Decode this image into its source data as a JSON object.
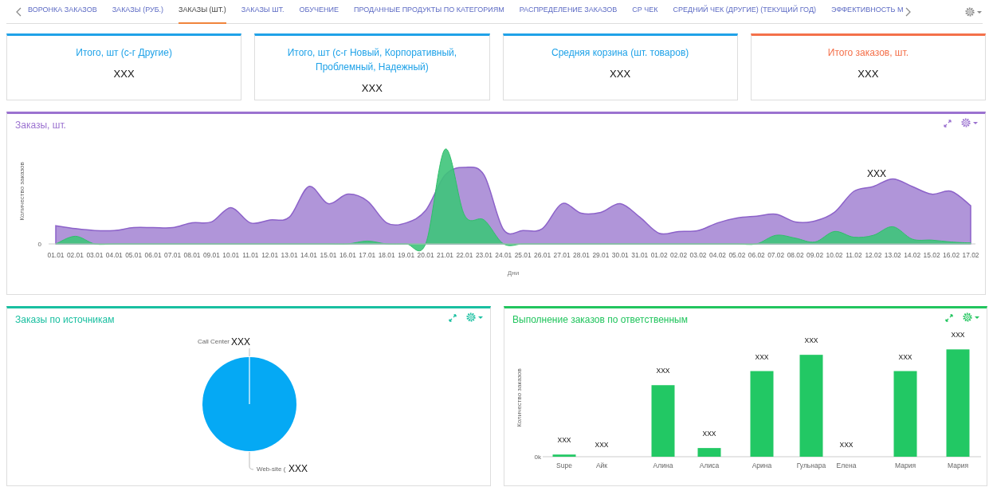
{
  "tabs": [
    {
      "label": "ВОРОНКА ЗАКАЗОВ",
      "selected": false
    },
    {
      "label": "ЗАКАЗЫ (РУБ.)",
      "selected": false
    },
    {
      "label": "ЗАКАЗЫ (ШТ.)",
      "selected": true
    },
    {
      "label": "ЗАКАЗЫ ШТ.",
      "selected": false
    },
    {
      "label": "ОБУЧЕНИЕ",
      "selected": false
    },
    {
      "label": "ПРОДАННЫЕ ПРОДУКТЫ ПО КАТЕГОРИЯМ",
      "selected": false
    },
    {
      "label": "РАСПРЕДЕЛЕНИЕ ЗАКАЗОВ",
      "selected": false
    },
    {
      "label": "СР ЧЕК",
      "selected": false
    },
    {
      "label": "СРЕДНИЙ ЧЕК (ДРУГИЕ) (ТЕКУЩИЙ ГОД)",
      "selected": false
    },
    {
      "label": "ЭФФЕКТИВНОСТЬ М",
      "selected": false
    }
  ],
  "kpis": [
    {
      "title": "Итого, шт (с-г Другие)",
      "value": "XXX",
      "color": "#1fa2e8"
    },
    {
      "title": "Итого, шт (с-г Новый, Корпоративный, Проблемный, Надежный)",
      "value": "XXX",
      "color": "#1fa2e8"
    },
    {
      "title": "Средняя корзина (шт. товаров)",
      "value": "XXX",
      "color": "#1fa2e8"
    },
    {
      "title": "Итого заказов, шт.",
      "value": "XXX",
      "color": "#f4704a"
    }
  ],
  "orders_chart": {
    "title": "Заказы, шт.",
    "ylabel": "Количество заказов",
    "y_zero": "0",
    "xlabel": "Дни",
    "peak_label": "XXX",
    "x_labels": [
      "01.01",
      "02.01",
      "03.01",
      "04.01",
      "05.01",
      "06.01",
      "07.01",
      "08.01",
      "09.01",
      "10.01",
      "11.01",
      "12.01",
      "13.01",
      "14.01",
      "15.01",
      "16.01",
      "17.01",
      "18.01",
      "19.01",
      "20.01",
      "21.01",
      "22.01",
      "23.01",
      "24.01",
      "25.01",
      "26.01",
      "27.01",
      "28.01",
      "29.01",
      "30.01",
      "31.01",
      "01.02",
      "02.02",
      "03.02",
      "04.02",
      "05.02",
      "06.02",
      "07.02",
      "08.02",
      "09.02",
      "10.02",
      "11.02",
      "12.02",
      "13.02",
      "14.02",
      "15.02",
      "16.02",
      "17.02"
    ]
  },
  "sources_chart": {
    "title": "Заказы по источникам",
    "slices": [
      {
        "label": "Call Center",
        "value_label": "XXX"
      },
      {
        "label": "Web-site (",
        "value_label": "XXX"
      }
    ]
  },
  "assignees_chart": {
    "title": "Выполнение заказов по ответственным",
    "ylabel": "Количество заказов",
    "y_zero": "0k",
    "bars": [
      {
        "name": "Supe",
        "value_label": "XXX"
      },
      {
        "name": "Айк",
        "value_label": "XXX"
      },
      {
        "name": "Алина",
        "value_label": "XXX"
      },
      {
        "name": "Алиса",
        "value_label": "XXX"
      },
      {
        "name": "Арина",
        "value_label": "XXX"
      },
      {
        "name": "Гульнара",
        "value_label": "XXX"
      },
      {
        "name": "Елена",
        "value_label": "XXX"
      },
      {
        "name": "Мария",
        "value_label": "XXX"
      },
      {
        "name": "Мария",
        "value_label": "XXX"
      }
    ]
  }
}
